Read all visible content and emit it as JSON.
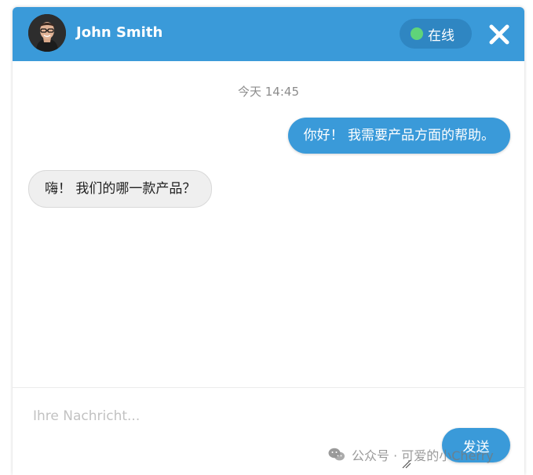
{
  "header": {
    "user_name": "John Smith",
    "status_label": "在线",
    "status_color": "#5fd47a",
    "close_icon": "close-icon",
    "accent_color": "#3a9ad9"
  },
  "conversation": {
    "timestamp": "今天 14:45",
    "messages": [
      {
        "direction": "outgoing",
        "text": "你好！ 我需要产品方面的帮助。"
      },
      {
        "direction": "incoming",
        "text": "嗨！ 我们的哪一款产品？"
      }
    ]
  },
  "composer": {
    "placeholder": "Ihre Nachricht...",
    "value": "",
    "send_label": "发送"
  },
  "watermark": {
    "text": "公众号 · 可爱的小Cherry",
    "icon": "wechat-icon"
  }
}
